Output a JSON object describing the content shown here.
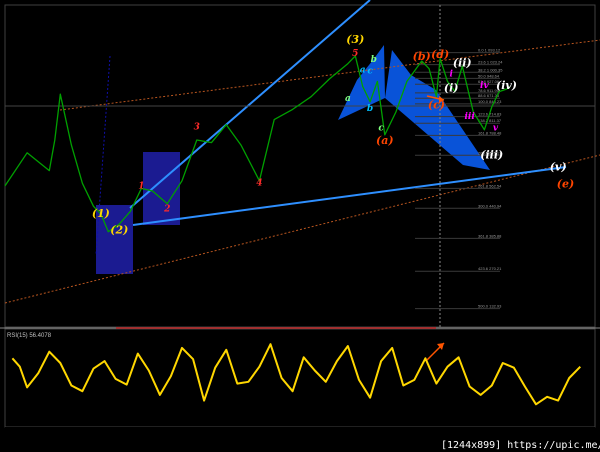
{
  "price_panel": {
    "wave_labels": [
      {
        "text": "(3)",
        "x": 9.5,
        "y": 80.0,
        "color": "#ffd700",
        "italic": true
      },
      {
        "text": "5",
        "x": 9.5,
        "y": 79.5,
        "color": "#ff2a2a",
        "italic": true
      },
      {
        "text": "3",
        "x": 5.2,
        "y": 76.62,
        "color": "#ff2a2a",
        "italic": true
      },
      {
        "text": "1",
        "x": 3.7,
        "y": 74.3,
        "color": "#ff2a2a",
        "italic": true
      },
      {
        "text": "2",
        "x": 4.4,
        "y": 73.39,
        "color": "#ff2a2a",
        "italic": true
      },
      {
        "text": "4",
        "x": 6.9,
        "y": 74.42,
        "color": "#ff2a2a",
        "italic": true
      },
      {
        "text": "(1)",
        "x": 2.6,
        "y": 73.17,
        "color": "#ffd700",
        "italic": true
      },
      {
        "text": "(2)",
        "x": 3.1,
        "y": 72.54,
        "color": "#ffd700",
        "italic": true
      },
      {
        "text": "(a)",
        "x": 10.3,
        "y": 76.04,
        "color": "#ff4500",
        "italic": true
      },
      {
        "text": "(b)",
        "x": 11.3,
        "y": 79.34,
        "color": "#ff4500",
        "italic": true
      },
      {
        "text": "(c)",
        "x": 11.7,
        "y": 77.44,
        "color": "#ff4500",
        "italic": true
      },
      {
        "text": "(d)",
        "x": 11.8,
        "y": 79.42,
        "color": "#ff4500",
        "italic": true
      },
      {
        "text": "(e)",
        "x": 15.2,
        "y": 74.34,
        "color": "#ff4500",
        "italic": true
      },
      {
        "text": "(i)",
        "x": 12.1,
        "y": 78.11,
        "color": "#ffffff",
        "italic": true
      },
      {
        "text": "(ii)",
        "x": 12.4,
        "y": 79.09,
        "color": "#ffffff",
        "italic": true
      },
      {
        "text": "(iii)",
        "x": 13.2,
        "y": 75.47,
        "color": "#ffffff",
        "italic": true
      },
      {
        "text": "(iv)",
        "x": 13.6,
        "y": 78.2,
        "color": "#ffffff",
        "italic": true
      },
      {
        "text": "(v)",
        "x": 15.0,
        "y": 75.01,
        "color": "#ffffff",
        "italic": true
      },
      {
        "text": "a",
        "x": 9.3,
        "y": 77.74,
        "color": "#7fff7f",
        "italic": true
      },
      {
        "text": "b",
        "x": 9.9,
        "y": 77.33,
        "color": "#00bfff",
        "italic": true
      },
      {
        "text": "c",
        "x": 10.2,
        "y": 76.57,
        "color": "#7fff7f",
        "italic": true
      },
      {
        "text": "a",
        "x": 9.7,
        "y": 78.85,
        "color": "#00bfff",
        "italic": true
      },
      {
        "text": "b",
        "x": 10.0,
        "y": 79.27,
        "color": "#7fff7f",
        "italic": true
      },
      {
        "text": "c",
        "x": 9.9,
        "y": 78.81,
        "color": "#00bfff",
        "italic": true
      },
      {
        "text": "i",
        "x": 12.1,
        "y": 78.7,
        "color": "#ff00ff",
        "italic": true
      },
      {
        "text": "iii",
        "x": 12.6,
        "y": 77.02,
        "color": "#ff00ff",
        "italic": true
      },
      {
        "text": "iv",
        "x": 13.0,
        "y": 78.24,
        "color": "#ff00ff",
        "italic": true
      },
      {
        "text": "v",
        "x": 13.3,
        "y": 76.57,
        "color": "#ff00ff",
        "italic": true
      }
    ],
    "fib_levels": [
      {
        "label": "0.0 1 093.12",
        "value": 79.63
      },
      {
        "label": "23.6 1 023.24",
        "value": 79.16
      },
      {
        "label": "38.2 1 000.35",
        "value": 78.86
      },
      {
        "label": "50.0 948.64",
        "value": 78.62
      },
      {
        "label": "61.8 927.06",
        "value": 78.39
      },
      {
        "label": "78.6 911.95",
        "value": 78.05
      },
      {
        "label": "88.6 671.35",
        "value": 77.84
      },
      {
        "label": "100.0 848.23",
        "value": 77.62
      },
      {
        "label": "123.6 714.83",
        "value": 77.12
      },
      {
        "label": "138.2 811.37",
        "value": 76.86
      },
      {
        "label": "161.8 788.48",
        "value": 76.38
      },
      {
        "label": "200.0 676.17",
        "value": 75.6
      },
      {
        "label": "261.8 562.54",
        "value": 74.3
      },
      {
        "label": "300.0 440.94",
        "value": 73.52
      },
      {
        "label": "361.8 385.88",
        "value": 72.34
      },
      {
        "label": "423.6 270.21",
        "value": 71.05
      },
      {
        "label": "500.0 132.93",
        "value": 69.58
      }
    ]
  },
  "rsi_panel": {
    "label": "RSI(15) 56.4078"
  },
  "watermark": "[1244x899] https://upic.me/",
  "chart_data": [
    {
      "type": "line",
      "title": "",
      "xlabel": "",
      "ylabel": "",
      "ylim": [
        68.86,
        81.5
      ],
      "xlim": [
        0,
        16
      ],
      "grid": false,
      "legend": "none",
      "series": [
        {
          "color": "#00a000",
          "x": [
            0,
            0.6,
            1.2,
            1.35,
            1.5,
            1.8,
            2.1,
            2.4,
            2.6,
            2.8,
            3.1,
            3.4,
            3.7,
            4.0,
            4.4,
            4.8,
            5.2,
            5.6,
            6.0,
            6.4,
            6.9,
            7.3,
            7.8,
            8.3,
            8.8,
            9.3,
            9.5,
            9.7,
            9.9,
            10.1,
            10.3,
            10.6,
            10.9,
            11.1,
            11.3,
            11.5,
            11.7,
            11.8,
            12.0,
            12.1,
            12.2,
            12.4,
            12.7,
            13.0,
            13.2,
            13.4,
            13.6,
            13.7
          ],
          "y": [
            74.4,
            75.7,
            75.0,
            76.2,
            78.0,
            76.0,
            74.5,
            73.6,
            73.3,
            72.6,
            72.9,
            73.4,
            74.3,
            74.2,
            73.7,
            74.6,
            76.2,
            76.1,
            76.8,
            76.0,
            74.6,
            77.0,
            77.4,
            77.9,
            78.6,
            79.2,
            79.5,
            78.3,
            77.7,
            78.5,
            76.4,
            77.3,
            78.5,
            78.9,
            79.3,
            79.0,
            77.9,
            79.4,
            78.5,
            78.3,
            78.1,
            79.1,
            77.3,
            76.6,
            77.5,
            78.1,
            78.2,
            78.3
          ]
        }
      ]
    },
    {
      "type": "line",
      "title": "",
      "xlabel": "",
      "ylabel": "",
      "ylim": [
        0,
        100
      ],
      "xlim": [
        0,
        16
      ],
      "grid": false,
      "legend": "none",
      "series": [
        {
          "color": "#ffd700",
          "x": [
            0.2,
            0.4,
            0.6,
            0.9,
            1.2,
            1.5,
            1.8,
            2.1,
            2.4,
            2.7,
            3.0,
            3.3,
            3.6,
            3.9,
            4.2,
            4.5,
            4.8,
            5.1,
            5.4,
            5.7,
            6.0,
            6.3,
            6.6,
            6.9,
            7.2,
            7.5,
            7.8,
            8.1,
            8.4,
            8.7,
            9.0,
            9.3,
            9.6,
            9.9,
            10.2,
            10.5,
            10.8,
            11.1,
            11.4,
            11.7,
            12.0,
            12.3,
            12.6,
            12.9,
            13.2,
            13.5,
            13.8,
            14.1,
            14.4,
            14.7,
            15.0,
            15.3,
            15.6
          ],
          "y": [
            71,
            62,
            40,
            55,
            78,
            66,
            42,
            36,
            60,
            68,
            49,
            43,
            76,
            58,
            32,
            52,
            82,
            70,
            26,
            61,
            80,
            44,
            46,
            62,
            86,
            50,
            36,
            72,
            58,
            46,
            68,
            84,
            48,
            29,
            68,
            82,
            42,
            48,
            71,
            44,
            62,
            72,
            41,
            32,
            42,
            66,
            61,
            41,
            22,
            30,
            26,
            50,
            62
          ]
        }
      ]
    }
  ]
}
